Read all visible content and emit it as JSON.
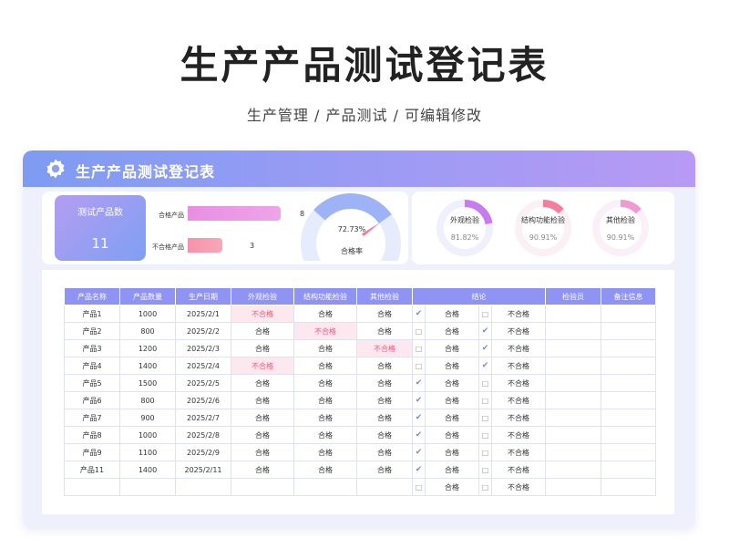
{
  "page": {
    "title": "生产产品测试登记表",
    "subtitle": "生产管理 / 产品测试 /  可编辑修改"
  },
  "header": {
    "title": "生产产品测试登记表",
    "icon": "gear-icon"
  },
  "summary": {
    "count_label": "测试产品数",
    "count_value": "11",
    "bars": [
      {
        "label": "合格产品",
        "value": 8,
        "color": "#e98ee3"
      },
      {
        "label": "不合格产品",
        "value": 3,
        "color": "#f692a9"
      }
    ],
    "gauge": {
      "value": "72.73%",
      "fraction": 0.7273,
      "caption": "合格率"
    }
  },
  "donuts": [
    {
      "label": "外观检验",
      "value": "81.82%",
      "fraction": 0.8182,
      "color": "#c67cef"
    },
    {
      "label": "结构功能检验",
      "value": "90.91%",
      "fraction": 0.9091,
      "color": "#f47f9d"
    },
    {
      "label": "其他检验",
      "value": "90.91%",
      "fraction": 0.9091,
      "color": "#f09ad2"
    }
  ],
  "table": {
    "columns": [
      "产品名称",
      "产品数量",
      "生产日期",
      "外观检验",
      "结构功能检验",
      "其他检验",
      "结论",
      "检验员",
      "备注信息"
    ],
    "rows": [
      [
        "产品1",
        "1000",
        "2025/2/1",
        "不合格",
        "合格",
        "合格",
        "✔",
        "合格",
        "□",
        "不合格",
        "",
        ""
      ],
      [
        "产品2",
        "800",
        "2025/2/2",
        "合格",
        "不合格",
        "合格",
        "□",
        "合格",
        "✔",
        "不合格",
        "",
        ""
      ],
      [
        "产品3",
        "1200",
        "2025/2/3",
        "合格",
        "合格",
        "不合格",
        "□",
        "合格",
        "✔",
        "不合格",
        "",
        ""
      ],
      [
        "产品4",
        "1400",
        "2025/2/4",
        "不合格",
        "合格",
        "合格",
        "□",
        "合格",
        "✔",
        "不合格",
        "",
        ""
      ],
      [
        "产品5",
        "1500",
        "2025/2/5",
        "合格",
        "合格",
        "合格",
        "✔",
        "合格",
        "□",
        "不合格",
        "",
        ""
      ],
      [
        "产品6",
        "800",
        "2025/2/6",
        "合格",
        "合格",
        "合格",
        "✔",
        "合格",
        "□",
        "不合格",
        "",
        ""
      ],
      [
        "产品7",
        "900",
        "2025/2/7",
        "合格",
        "合格",
        "合格",
        "✔",
        "合格",
        "□",
        "不合格",
        "",
        ""
      ],
      [
        "产品8",
        "1000",
        "2025/2/8",
        "合格",
        "合格",
        "合格",
        "✔",
        "合格",
        "□",
        "不合格",
        "",
        ""
      ],
      [
        "产品9",
        "1100",
        "2025/2/9",
        "合格",
        "合格",
        "合格",
        "✔",
        "合格",
        "□",
        "不合格",
        "",
        ""
      ],
      [
        "产品11",
        "1400",
        "2025/2/11",
        "合格",
        "合格",
        "合格",
        "✔",
        "合格",
        "□",
        "不合格",
        "",
        ""
      ],
      [
        "",
        "",
        "",
        "",
        "",
        "",
        "□",
        "合格",
        "□",
        "不合格",
        "",
        ""
      ]
    ]
  }
}
